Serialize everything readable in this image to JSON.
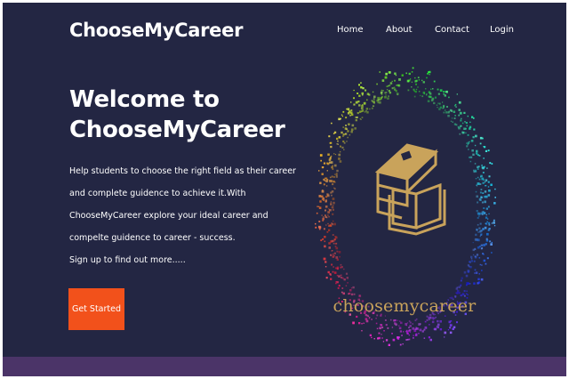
{
  "brand": {
    "name": "ChooseMyCareer"
  },
  "nav": {
    "items": [
      {
        "label": "Home"
      },
      {
        "label": "About"
      },
      {
        "label": "Contact"
      },
      {
        "label": "Login"
      }
    ]
  },
  "hero": {
    "headline_line1": "Welcome to",
    "headline_line2": "ChooseMyCareer",
    "description_lines": [
      "Help students to choose the right field as their career",
      "and complete guidence to achieve it.With",
      "ChooseMyCareer explore your ideal career and",
      "compelte guidence to career - success.",
      "Sign up to find out more....."
    ],
    "cta_label": "Get Started"
  },
  "logo": {
    "icon": "books-icon",
    "wordmark": "choosemycareer"
  },
  "colors": {
    "background": "#232643",
    "accent": "#f2511b",
    "gold": "#c9a35b",
    "footer": "#4b3468"
  }
}
